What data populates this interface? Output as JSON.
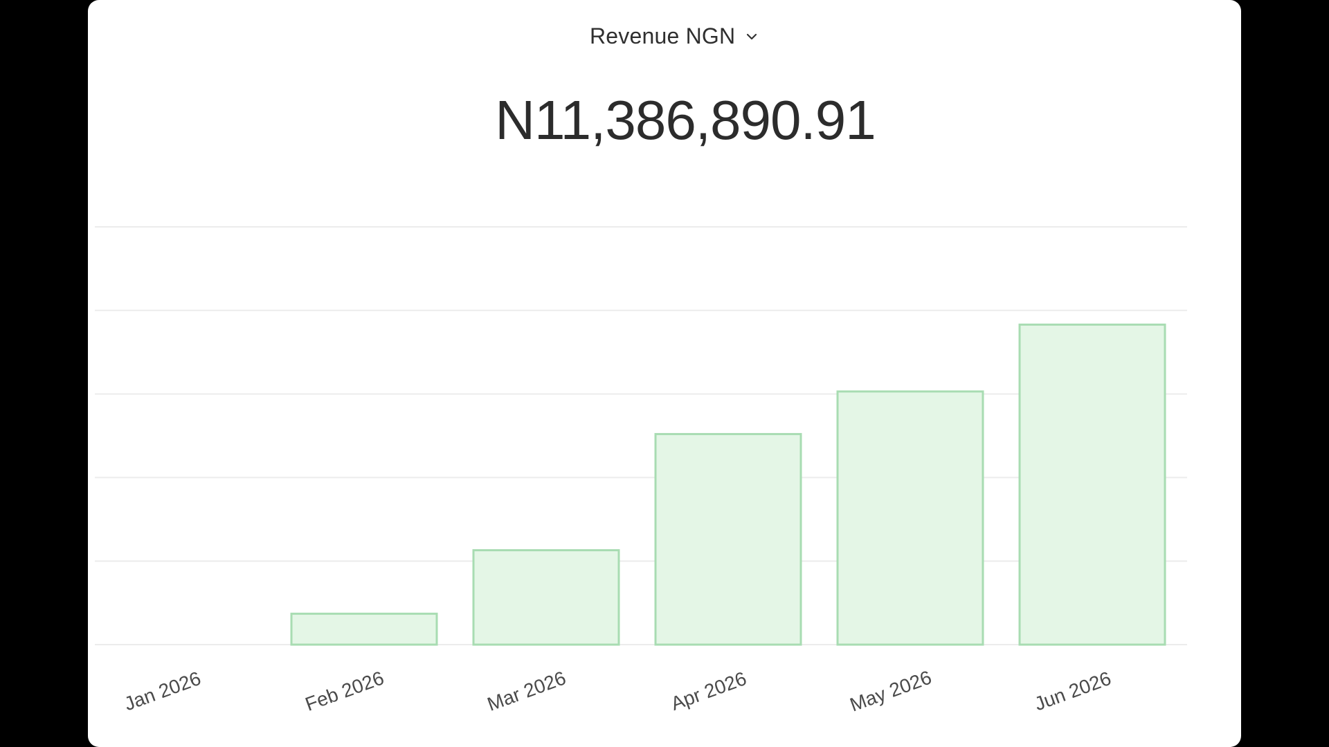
{
  "header": {
    "metric_label": "Revenue NGN",
    "total_value": "N11,386,890.91"
  },
  "colors": {
    "bar_fill": "#e4f6e6",
    "bar_stroke": "#a8dcb2",
    "grid": "#ececec",
    "tick_text": "#4a4a4a"
  },
  "chart_data": {
    "type": "bar",
    "categories": [
      "Jan 2026",
      "Feb 2026",
      "Mar 2026",
      "Apr 2026",
      "May 2026",
      "Jun 2026"
    ],
    "values": [
      0,
      0.37,
      1.13,
      2.52,
      3.03,
      3.83
    ],
    "ylim": [
      0,
      5
    ],
    "grid": true,
    "y_tick_labels_visible": false,
    "title": "",
    "xlabel": "",
    "ylabel": ""
  }
}
